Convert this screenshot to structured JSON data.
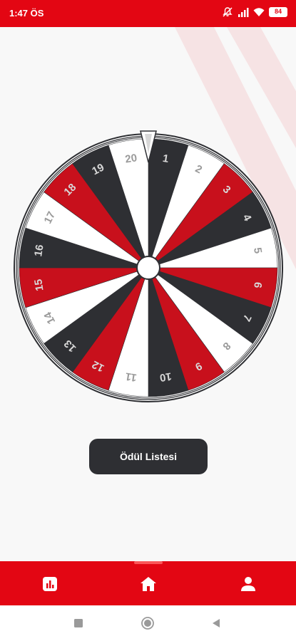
{
  "status_bar": {
    "time": "1:47 ÖS",
    "battery": "84",
    "icons": [
      "silent-mode-icon",
      "signal-icon",
      "wifi-icon",
      "battery-icon"
    ]
  },
  "wheel": {
    "numbers": [
      "1",
      "2",
      "3",
      "4",
      "5",
      "6",
      "7",
      "8",
      "9",
      "10",
      "11",
      "12",
      "13",
      "14",
      "15",
      "16",
      "17",
      "18",
      "19",
      "20"
    ],
    "colors": {
      "dark": "#2e2f33",
      "red": "#c8101c",
      "white": "#ffffff"
    }
  },
  "prize_button": {
    "label": "Ödül Listesi"
  },
  "bottom_nav": {
    "items": [
      {
        "icon": "stats-icon"
      },
      {
        "icon": "home-icon"
      },
      {
        "icon": "user-icon"
      }
    ]
  },
  "system_nav": {
    "buttons": [
      "recent-apps-icon",
      "home-circle-icon",
      "back-icon"
    ]
  },
  "theme": {
    "accent": "#e30613",
    "dark": "#2e2f33"
  }
}
